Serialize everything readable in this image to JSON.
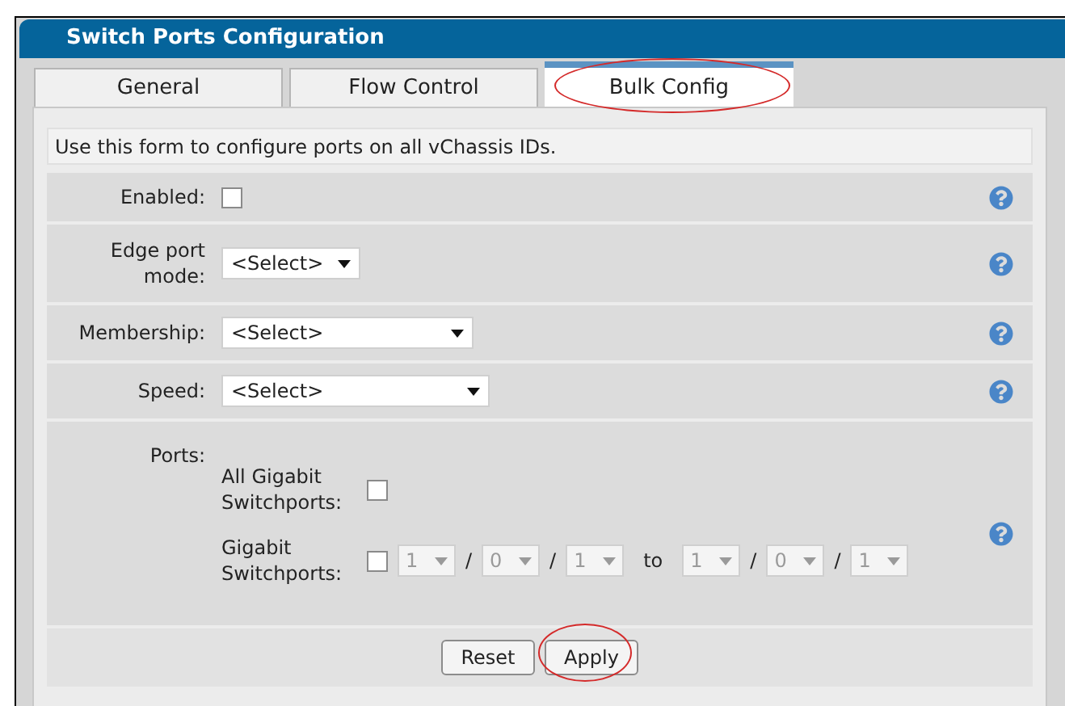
{
  "window": {
    "title": "Switch Ports Configuration"
  },
  "tabs": [
    {
      "label": "General",
      "selected": false,
      "highlighted": false
    },
    {
      "label": "Flow Control",
      "selected": false,
      "highlighted": false
    },
    {
      "label": "Bulk Config",
      "selected": true,
      "highlighted": true
    }
  ],
  "intro": "Use this form to configure ports on all vChassis IDs.",
  "fields": [
    {
      "kind": "checkbox",
      "label": "Enabled:",
      "checked": false
    },
    {
      "kind": "select",
      "label": "Edge port mode:",
      "value": "<Select>"
    },
    {
      "kind": "select",
      "label": "Membership:",
      "value": "<Select>"
    },
    {
      "kind": "select",
      "label": "Speed:",
      "value": "<Select>"
    }
  ],
  "ports": {
    "label": "Ports:",
    "all": {
      "label": "All Gigabit Switchports:",
      "checked": false
    },
    "range": {
      "label": "Gigabit Switchports:",
      "checked": false,
      "items": [
        {
          "kind": "select",
          "value": "1",
          "disabled": true
        },
        {
          "kind": "text",
          "text": "/"
        },
        {
          "kind": "select",
          "value": "0",
          "disabled": true
        },
        {
          "kind": "text",
          "text": "/"
        },
        {
          "kind": "select",
          "value": "1",
          "disabled": true
        },
        {
          "kind": "word",
          "text": "to"
        },
        {
          "kind": "select",
          "value": "1",
          "disabled": true
        },
        {
          "kind": "text",
          "text": "/"
        },
        {
          "kind": "select",
          "value": "0",
          "disabled": true
        },
        {
          "kind": "text",
          "text": "/"
        },
        {
          "kind": "select",
          "value": "1",
          "disabled": true
        }
      ]
    }
  },
  "buttons": [
    {
      "label": "Reset",
      "highlighted": false
    },
    {
      "label": "Apply",
      "highlighted": true
    }
  ]
}
